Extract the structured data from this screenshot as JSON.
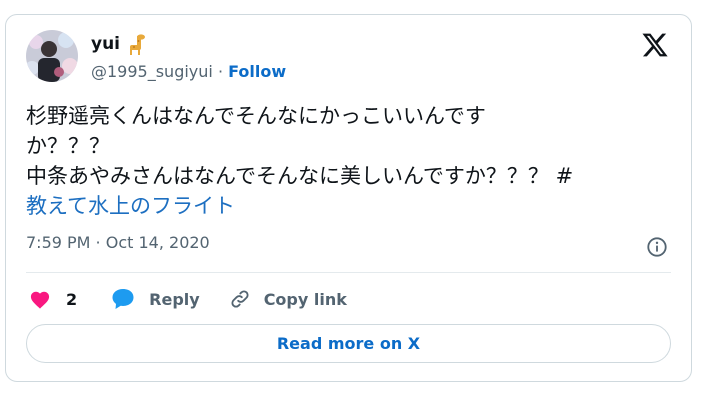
{
  "user": {
    "name": "yui",
    "emoji": "giraffe",
    "handle": "@1995_sugiyui",
    "separator": "·",
    "follow": "Follow"
  },
  "post": {
    "lines": [
      "杉野遥亮くんはなんでそんなにかっこいいんです",
      "か？？？",
      "中条あやみさんはなんでそんなに美しいんですか？？？ #"
    ],
    "hashtag": "教えて水上のフライト"
  },
  "meta": {
    "timestamp": "7:59 PM · Oct 14, 2020"
  },
  "actions": {
    "like_count": "2",
    "reply": "Reply",
    "copy_link": "Copy link"
  },
  "read_more": "Read more on X",
  "colors": {
    "link": "#0c6cc8",
    "like": "#f91880",
    "reply_icon": "#1d9bf0",
    "text": "#0f1419",
    "muted": "#536471",
    "border": "#cfd9de"
  },
  "icons": [
    "x-logo-icon",
    "info-icon",
    "heart-icon",
    "reply-bubble-icon",
    "copy-link-icon",
    "giraffe-emoji-icon"
  ]
}
